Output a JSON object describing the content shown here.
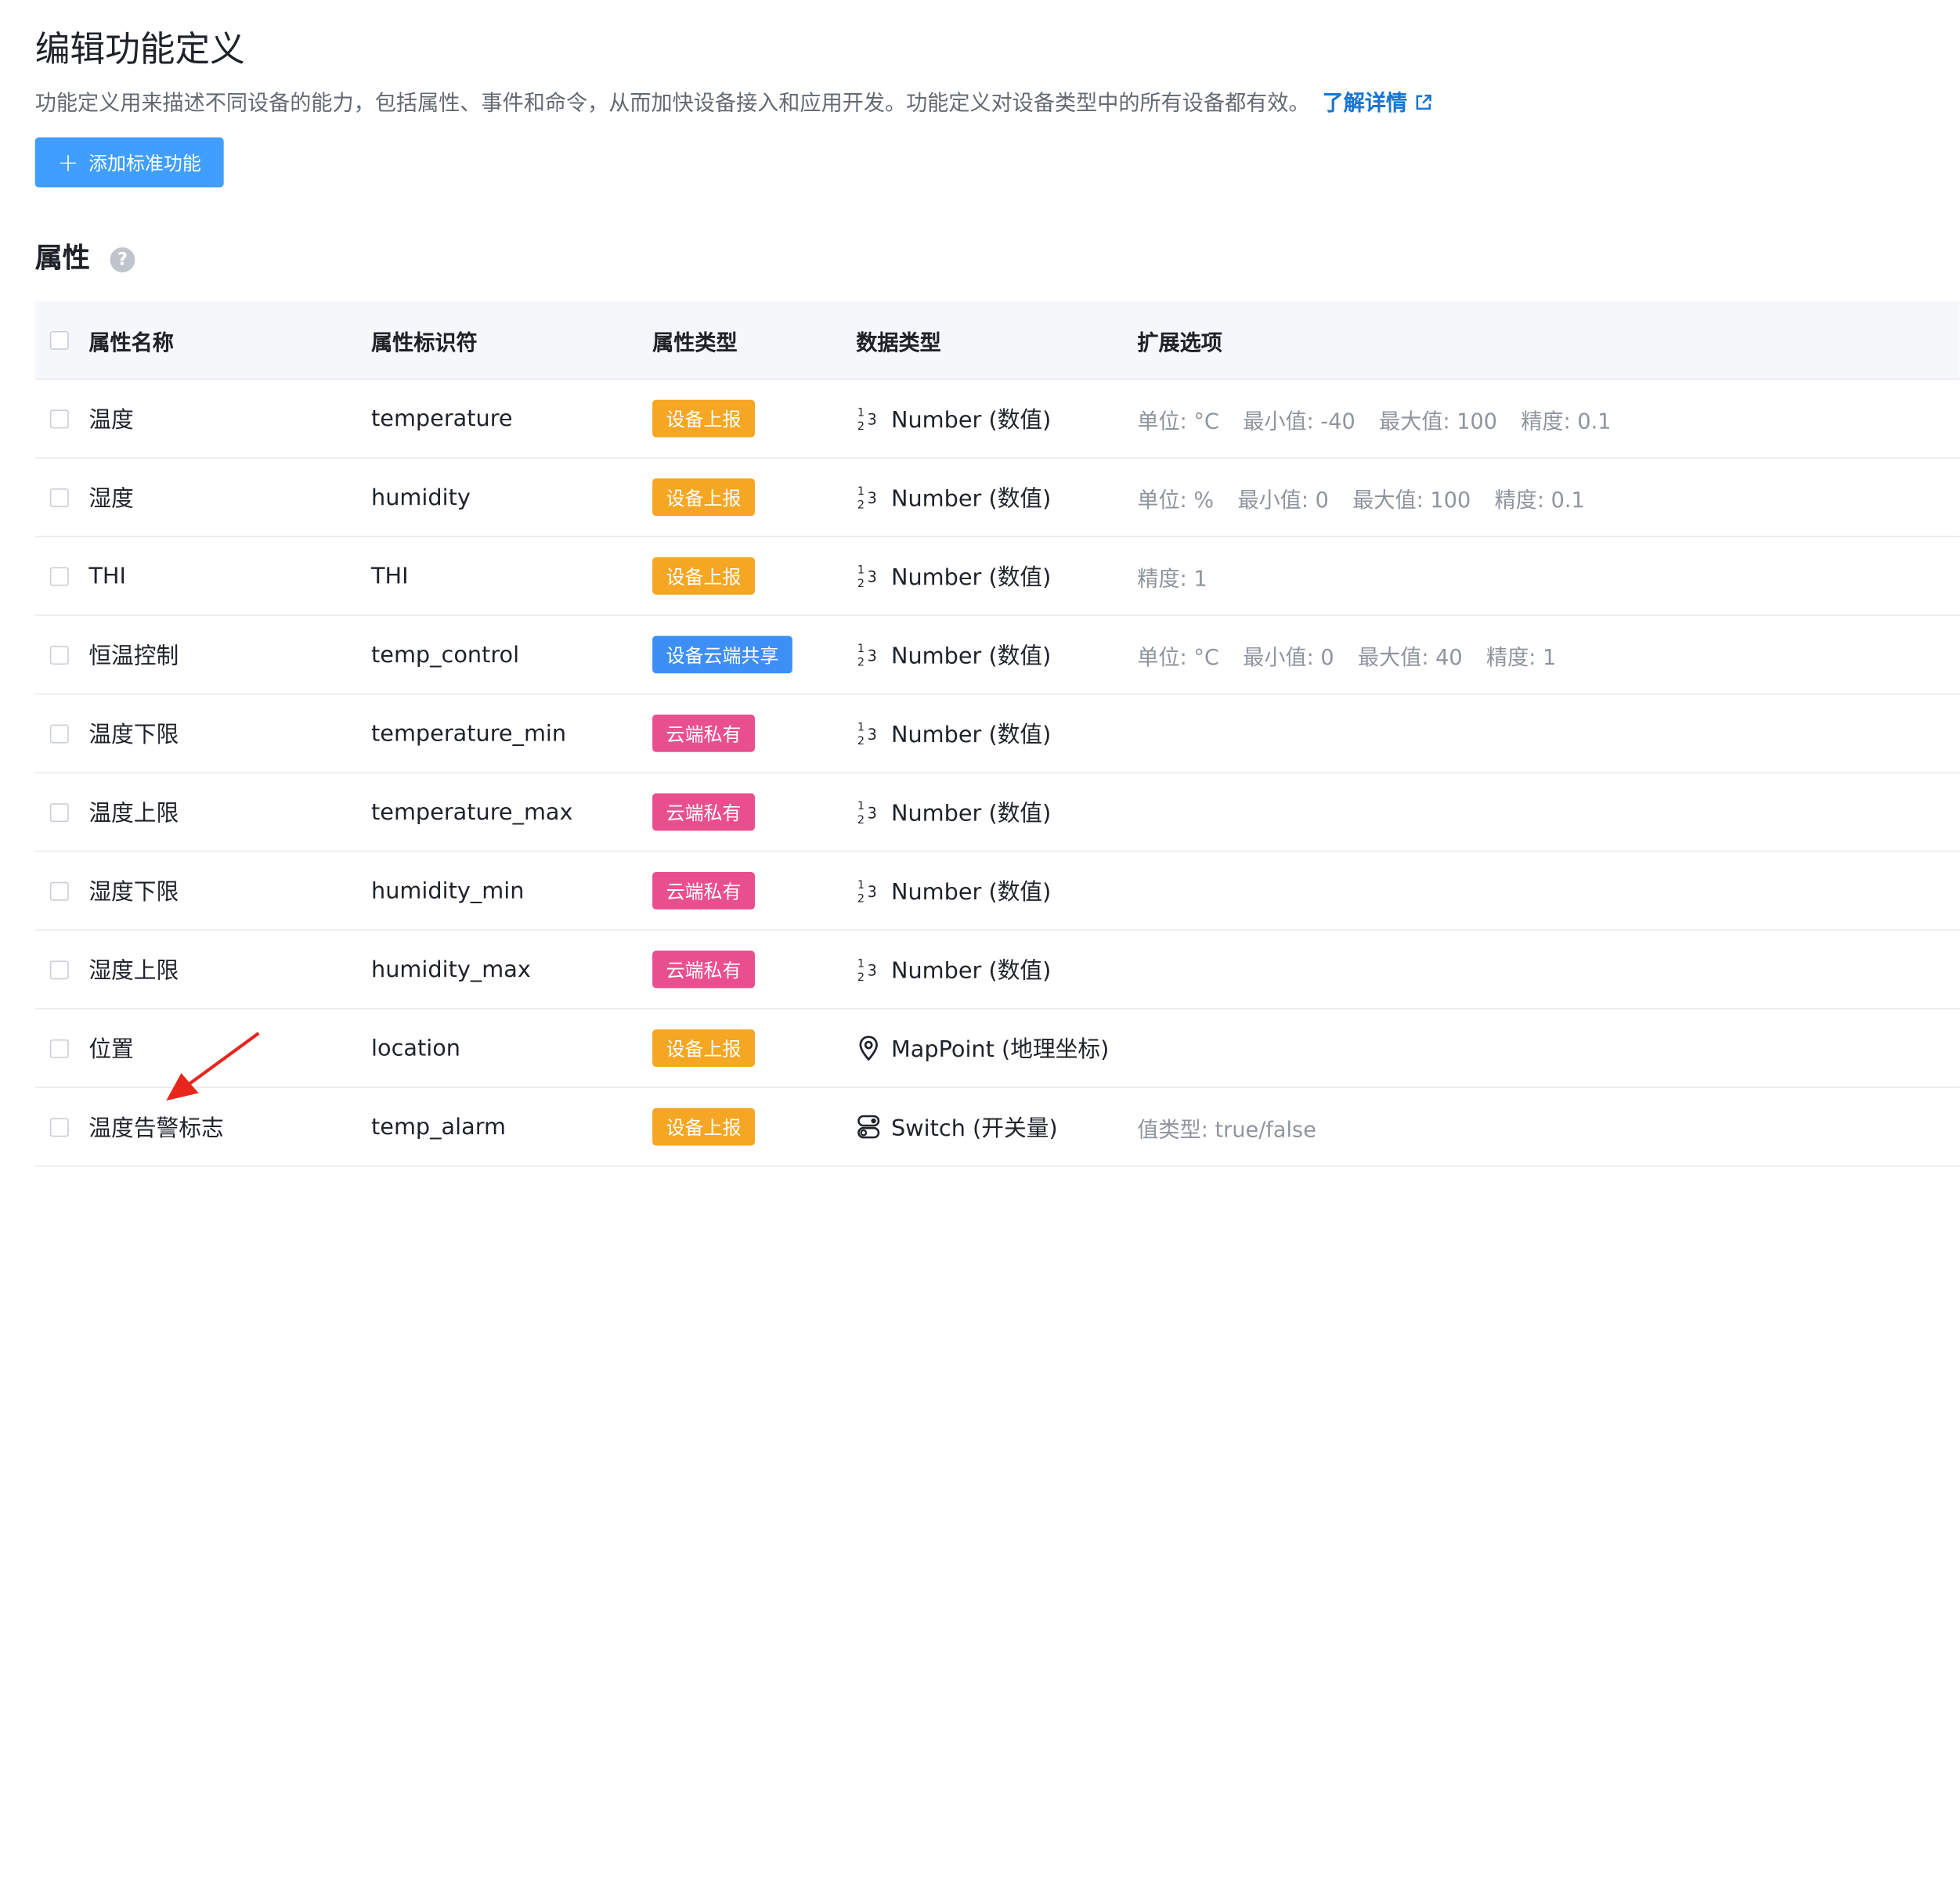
{
  "header": {
    "title": "编辑功能定义",
    "description": "功能定义用来描述不同设备的能力，包括属性、事件和命令，从而加快设备接入和应用开发。功能定义对设备类型中的所有设备都有效。",
    "learn_more": "了解详情",
    "add_button": "添加标准功能"
  },
  "section": {
    "title": "属性",
    "help": "?"
  },
  "columns": {
    "name": "属性名称",
    "identifier": "属性标识符",
    "attr_type": "属性类型",
    "data_type": "数据类型",
    "extension": "扩展选项"
  },
  "colors": {
    "accent": "#409eff",
    "link": "#1976d2",
    "tag_device_report": "#f5a623",
    "tag_device_cloud_shared": "#3d8ff5",
    "tag_cloud_private": "#e94f8f",
    "annotation_arrow": "#e8261d"
  },
  "rows": [
    {
      "name": "温度",
      "identifier": "temperature",
      "attr_type": "设备上报",
      "tag_color": "orange",
      "data_icon": "number-icon",
      "data_type": "Number (数值)",
      "ext": [
        "单位: °C",
        "最小值: -40",
        "最大值: 100",
        "精度: 0.1"
      ]
    },
    {
      "name": "湿度",
      "identifier": "humidity",
      "attr_type": "设备上报",
      "tag_color": "orange",
      "data_icon": "number-icon",
      "data_type": "Number (数值)",
      "ext": [
        "单位: %",
        "最小值: 0",
        "最大值: 100",
        "精度: 0.1"
      ]
    },
    {
      "name": "THI",
      "identifier": "THI",
      "attr_type": "设备上报",
      "tag_color": "orange",
      "data_icon": "number-icon",
      "data_type": "Number (数值)",
      "ext": [
        "精度: 1"
      ]
    },
    {
      "name": "恒温控制",
      "identifier": "temp_control",
      "attr_type": "设备云端共享",
      "tag_color": "blue",
      "data_icon": "number-icon",
      "data_type": "Number (数值)",
      "ext": [
        "单位: °C",
        "最小值: 0",
        "最大值: 40",
        "精度: 1"
      ]
    },
    {
      "name": "温度下限",
      "identifier": "temperature_min",
      "attr_type": "云端私有",
      "tag_color": "pink",
      "data_icon": "number-icon",
      "data_type": "Number (数值)",
      "ext": []
    },
    {
      "name": "温度上限",
      "identifier": "temperature_max",
      "attr_type": "云端私有",
      "tag_color": "pink",
      "data_icon": "number-icon",
      "data_type": "Number (数值)",
      "ext": []
    },
    {
      "name": "湿度下限",
      "identifier": "humidity_min",
      "attr_type": "云端私有",
      "tag_color": "pink",
      "data_icon": "number-icon",
      "data_type": "Number (数值)",
      "ext": []
    },
    {
      "name": "湿度上限",
      "identifier": "humidity_max",
      "attr_type": "云端私有",
      "tag_color": "pink",
      "data_icon": "number-icon",
      "data_type": "Number (数值)",
      "ext": []
    },
    {
      "name": "位置",
      "identifier": "location",
      "attr_type": "设备上报",
      "tag_color": "orange",
      "data_icon": "map-pin-icon",
      "data_type": "MapPoint (地理坐标)",
      "ext": []
    },
    {
      "name": "温度告警标志",
      "identifier": "temp_alarm",
      "attr_type": "设备上报",
      "tag_color": "orange",
      "data_icon": "switch-icon",
      "data_type": "Switch (开关量)",
      "ext": [
        "值类型: true/false"
      ]
    }
  ]
}
